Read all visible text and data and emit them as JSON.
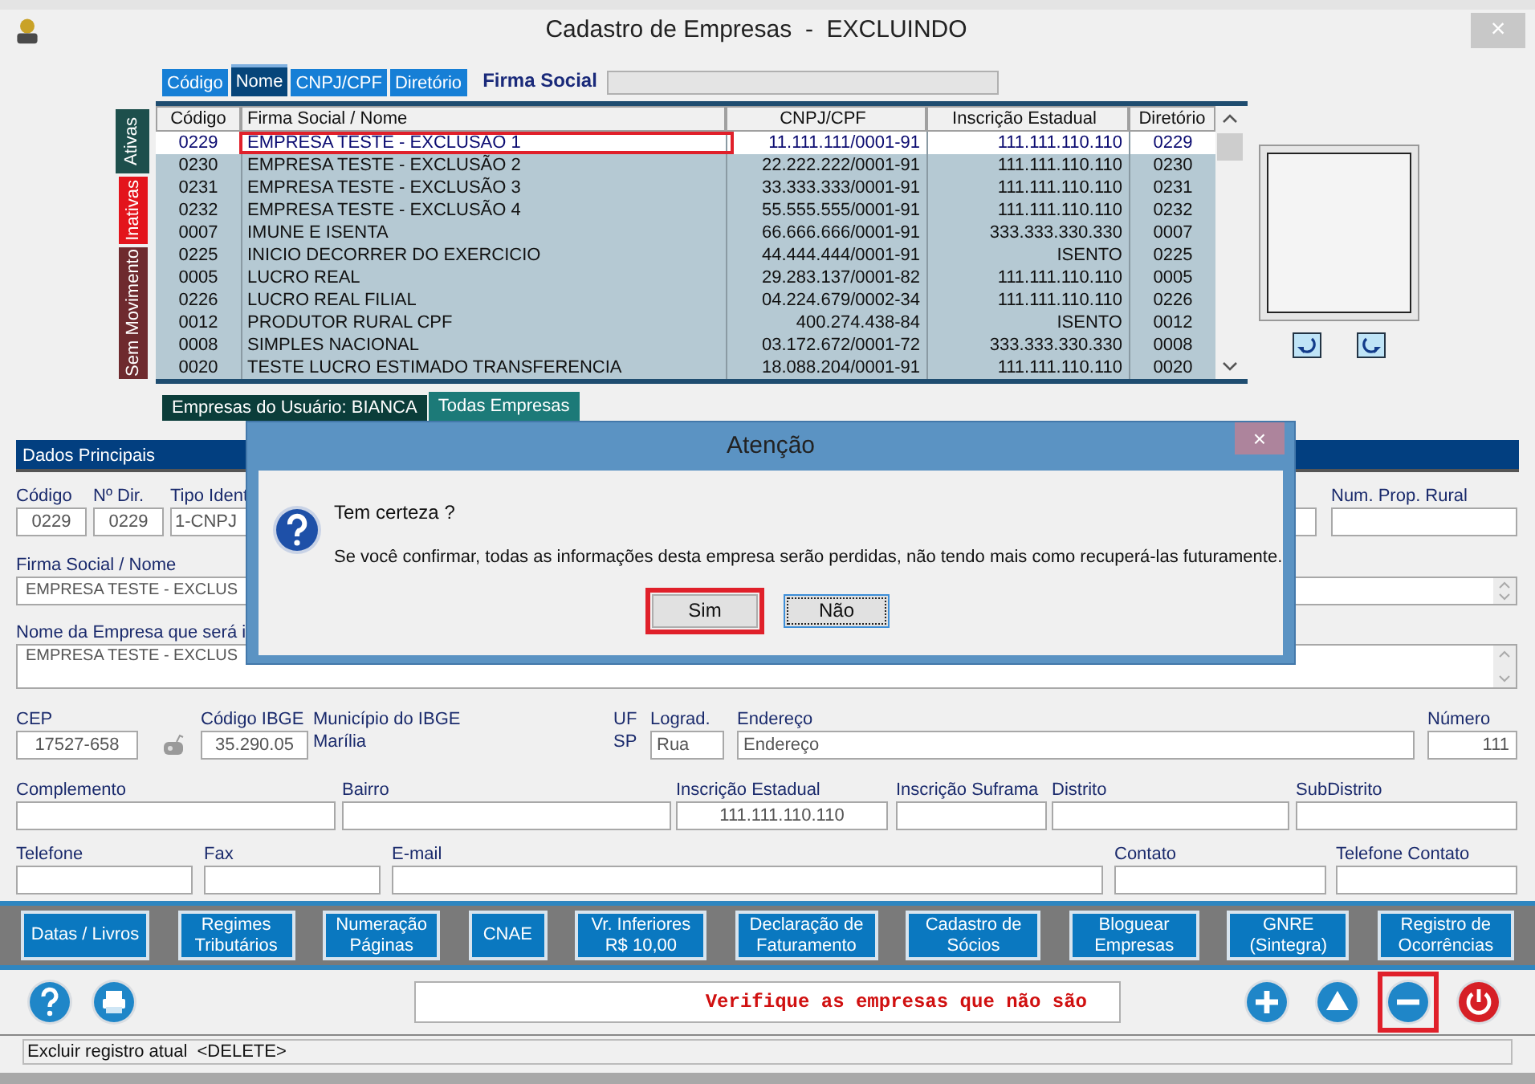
{
  "window": {
    "title": "Cadastro de Empresas  -  EXCLUINDO",
    "close": "×"
  },
  "search": {
    "tabs": [
      {
        "label": "Código",
        "selected": false
      },
      {
        "label": "Nome",
        "selected": true
      },
      {
        "label": "CNPJ/CPF",
        "selected": false
      },
      {
        "label": "Diretório",
        "selected": false
      }
    ],
    "label": "Firma Social"
  },
  "status_tabs": [
    {
      "label": "Ativas",
      "selected": true,
      "color": "#1d4f4c"
    },
    {
      "label": "Inativas",
      "selected": false,
      "color": "#e3141c"
    },
    {
      "label": "Sem Movimento",
      "selected": false,
      "color": "#6e2a2e"
    }
  ],
  "grid": {
    "columns": [
      "Código",
      "Firma Social / Nome",
      "CNPJ/CPF",
      "Inscrição Estadual",
      "Diretório"
    ],
    "rows": [
      {
        "cells": [
          "0229",
          "EMPRESA TESTE - EXCLUSAO 1",
          "11.111.111/0001-91",
          "111.111.110.110",
          "0229"
        ],
        "selected": true,
        "highlighted": true
      },
      {
        "cells": [
          "0230",
          "EMPRESA TESTE - EXCLUSÃO 2",
          "22.222.222/0001-91",
          "111.111.110.110",
          "0230"
        ],
        "selected": false,
        "highlighted": false
      },
      {
        "cells": [
          "0231",
          "EMPRESA TESTE - EXCLUSÃO 3",
          "33.333.333/0001-91",
          "111.111.110.110",
          "0231"
        ],
        "selected": false,
        "highlighted": false
      },
      {
        "cells": [
          "0232",
          "EMPRESA TESTE - EXCLUSÃO 4",
          "55.555.555/0001-91",
          "111.111.110.110",
          "0232"
        ],
        "selected": false,
        "highlighted": false
      },
      {
        "cells": [
          "0007",
          "IMUNE E ISENTA",
          "66.666.666/0001-91",
          "333.333.330.330",
          "0007"
        ],
        "selected": false,
        "highlighted": false
      },
      {
        "cells": [
          "0225",
          "INICIO DECORRER DO EXERCICIO",
          "44.444.444/0001-91",
          "ISENTO",
          "0225"
        ],
        "selected": false,
        "highlighted": false
      },
      {
        "cells": [
          "0005",
          "LUCRO REAL",
          "29.283.137/0001-82",
          "111.111.110.110",
          "0005"
        ],
        "selected": false,
        "highlighted": false
      },
      {
        "cells": [
          "0226",
          "LUCRO REAL FILIAL",
          "04.224.679/0002-34",
          "111.111.110.110",
          "0226"
        ],
        "selected": false,
        "highlighted": false
      },
      {
        "cells": [
          "0012",
          "PRODUTOR RURAL CPF",
          "400.274.438-84",
          "ISENTO",
          "0012"
        ],
        "selected": false,
        "highlighted": false
      },
      {
        "cells": [
          "0008",
          "SIMPLES NACIONAL",
          "03.172.672/0001-72",
          "333.333.330.330",
          "0008"
        ],
        "selected": false,
        "highlighted": false
      },
      {
        "cells": [
          "0020",
          "TESTE LUCRO ESTIMADO TRANSFERENCIA",
          "18.088.204/0001-91",
          "111.111.110.110",
          "0020"
        ],
        "selected": false,
        "highlighted": false
      }
    ]
  },
  "grid_tabs": [
    {
      "label": "Empresas do Usuário: BIANCA",
      "selected": false
    },
    {
      "label": "Todas Empresas",
      "selected": true
    }
  ],
  "section_title": "Dados Principais",
  "form": [
    [
      {
        "kind": "input",
        "label": "Código",
        "value": "0229"
      },
      {
        "kind": "input",
        "label": "Nº Dir.",
        "value": "0229"
      },
      {
        "kind": "input",
        "label": "Tipo Ident",
        "value": "1-CNPJ"
      },
      {
        "kind": "input"
      },
      {
        "kind": "input",
        "label": "Num. Prop. Rural"
      }
    ],
    [
      {
        "kind": "spin",
        "label": "Firma Social / Nome",
        "value": "EMPRESA TESTE - EXCLUS"
      }
    ],
    [
      {
        "kind": "memo",
        "label": "Nome da Empresa que será i",
        "value": "EMPRESA TESTE - EXCLUS"
      }
    ],
    [
      {
        "kind": "input",
        "label": "CEP",
        "value": "17527-658"
      },
      {
        "kind": "icon"
      },
      {
        "kind": "input",
        "label": "Código IBGE",
        "value": "35.290.05"
      },
      {
        "kind": "text",
        "label": "Município do IBGE",
        "value": "Marília"
      },
      {
        "kind": "text",
        "label": "UF",
        "value": "SP"
      },
      {
        "kind": "input",
        "label": "Lograd.",
        "value": "Rua"
      },
      {
        "kind": "input",
        "label": "Endereço",
        "value": "Endereço"
      },
      {
        "kind": "input",
        "label": "Número",
        "value": "111"
      }
    ],
    [
      {
        "kind": "input",
        "label": "Complemento"
      },
      {
        "kind": "input",
        "label": "Bairro"
      },
      {
        "kind": "input",
        "label": "Inscrição Estadual",
        "value": "111.111.110.110"
      },
      {
        "kind": "input",
        "label": "Inscrição Suframa"
      },
      {
        "kind": "input",
        "label": "Distrito"
      },
      {
        "kind": "input",
        "label": "SubDistrito"
      }
    ],
    [
      {
        "kind": "input",
        "label": "Telefone"
      },
      {
        "kind": "input",
        "label": "Fax"
      },
      {
        "kind": "input",
        "label": "E-mail"
      },
      {
        "kind": "input",
        "label": "Contato"
      },
      {
        "kind": "input",
        "label": "Telefone Contato"
      }
    ]
  ],
  "actions": [
    "Datas / Livros",
    "Regimes\nTributários",
    "Numeração\nPáginas",
    "CNAE",
    "Vr. Inferiores\nR$ 10,00",
    "Declaração de\nFaturamento",
    "Cadastro de\nSócios",
    "Bloguear\nEmpresas",
    "GNRE\n(Sintegra)",
    "Registro de\nOcorrências"
  ],
  "message": "Verifique as empresas que não são",
  "nav_buttons": [
    {
      "kind": "add",
      "highlighted": false
    },
    {
      "kind": "up",
      "highlighted": false
    },
    {
      "kind": "remove",
      "highlighted": true
    },
    {
      "kind": "power",
      "highlighted": false
    }
  ],
  "status_bar": "Excluir registro atual  <DELETE>",
  "dialog": {
    "title": "Atenção",
    "close": "×",
    "heading": "Tem certeza ?",
    "message": "Se você confirmar, todas as informações desta empresa serão perdidas, não tendo mais como recuperá-las futuramente.",
    "buttons": [
      {
        "label": "Sim",
        "highlighted": true,
        "focused": false
      },
      {
        "label": "Não",
        "highlighted": false,
        "focused": true
      }
    ]
  }
}
